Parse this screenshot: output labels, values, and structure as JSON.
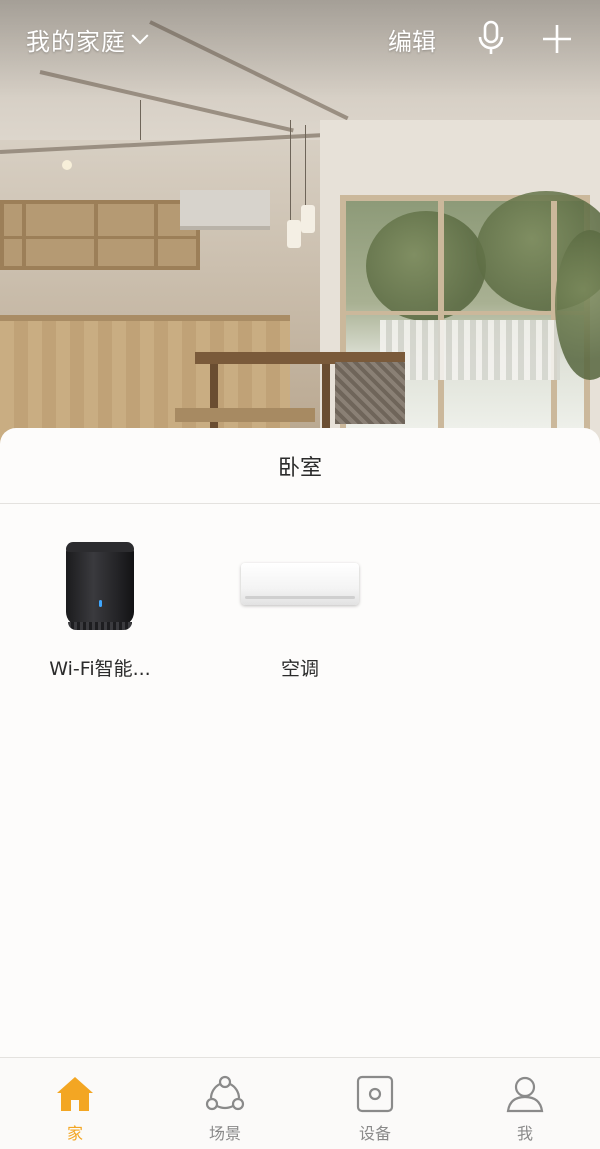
{
  "header": {
    "home_title": "我的家庭",
    "edit_label": "编辑",
    "icons": [
      "chevron-down-icon",
      "microphone-icon",
      "plus-icon"
    ]
  },
  "room": {
    "title": "卧室"
  },
  "devices": [
    {
      "name": "Wi-Fi智能...",
      "icon": "ir-remote-hub"
    },
    {
      "name": "空调",
      "icon": "air-conditioner"
    }
  ],
  "tabbar": {
    "tabs": [
      {
        "label": "家",
        "icon": "home-icon",
        "active": true
      },
      {
        "label": "场景",
        "icon": "scene-icon",
        "active": false
      },
      {
        "label": "设备",
        "icon": "device-icon",
        "active": false
      },
      {
        "label": "我",
        "icon": "user-icon",
        "active": false
      }
    ]
  },
  "colors": {
    "accent": "#f3a623",
    "inactive": "#8a8a8a",
    "text": "#2b2b2b"
  }
}
